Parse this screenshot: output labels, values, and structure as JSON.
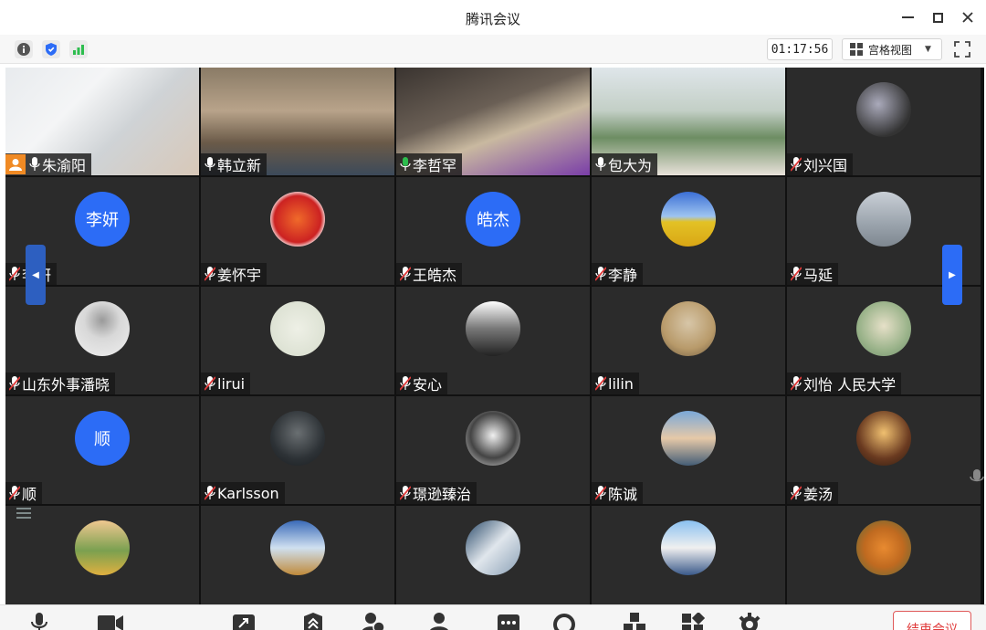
{
  "window": {
    "title": "腾讯会议"
  },
  "infobar": {
    "timer": "01:17:56",
    "view_label": "宫格视图"
  },
  "colors": {
    "accent": "#2c6cf6",
    "speaking": "#2dbd4e",
    "host": "#f08a24",
    "end": "#e03a3a"
  },
  "participants": [
    {
      "name": "朱渝阳",
      "type": "video",
      "host": true,
      "mic": "on"
    },
    {
      "name": "韩立新",
      "type": "video",
      "mic": "on"
    },
    {
      "name": "李哲罕",
      "type": "video",
      "mic": "speaking"
    },
    {
      "name": "包大为",
      "type": "video",
      "mic": "on"
    },
    {
      "name": "刘兴国",
      "type": "photo",
      "mic": "muted"
    },
    {
      "name": "李妍",
      "type": "text",
      "avatar_text": "李妍",
      "mic": "muted"
    },
    {
      "name": "姜怀宇",
      "type": "photo",
      "mic": "muted"
    },
    {
      "name": "王皓杰",
      "type": "text",
      "avatar_text": "皓杰",
      "mic": "muted"
    },
    {
      "name": "李静",
      "type": "photo",
      "mic": "muted"
    },
    {
      "name": "马延",
      "type": "photo",
      "mic": "muted"
    },
    {
      "name": "山东外事潘晓",
      "type": "photo",
      "mic": "muted"
    },
    {
      "name": "lirui",
      "type": "photo",
      "mic": "muted"
    },
    {
      "name": "安心",
      "type": "photo",
      "mic": "muted"
    },
    {
      "name": "lilin",
      "type": "photo",
      "mic": "muted"
    },
    {
      "name": "刘怡  人民大学",
      "type": "photo",
      "mic": "muted"
    },
    {
      "name": "顺",
      "type": "text",
      "avatar_text": "顺",
      "mic": "muted"
    },
    {
      "name": "Karlsson",
      "type": "photo",
      "mic": "muted"
    },
    {
      "name": "璟逊臻治",
      "type": "photo",
      "mic": "muted"
    },
    {
      "name": "陈诚",
      "type": "photo",
      "mic": "muted"
    },
    {
      "name": "姜汤",
      "type": "photo",
      "mic": "muted"
    },
    {
      "name": "",
      "type": "photo",
      "mic": "muted"
    },
    {
      "name": "",
      "type": "photo",
      "mic": "muted"
    },
    {
      "name": "",
      "type": "photo",
      "mic": "muted"
    },
    {
      "name": "",
      "type": "photo",
      "mic": "muted"
    },
    {
      "name": "",
      "type": "photo",
      "mic": "muted"
    }
  ],
  "toolbar": {
    "end_label": "结束会议"
  },
  "icons": [
    "info-icon",
    "shield-icon",
    "signal-icon",
    "grid-view-icon",
    "fullscreen-icon",
    "mic-icon",
    "camera-icon",
    "share-screen-icon",
    "security-icon",
    "invite-icon",
    "participants-icon",
    "chat-icon",
    "record-icon",
    "apps-icon",
    "layout-icon",
    "settings-icon"
  ]
}
